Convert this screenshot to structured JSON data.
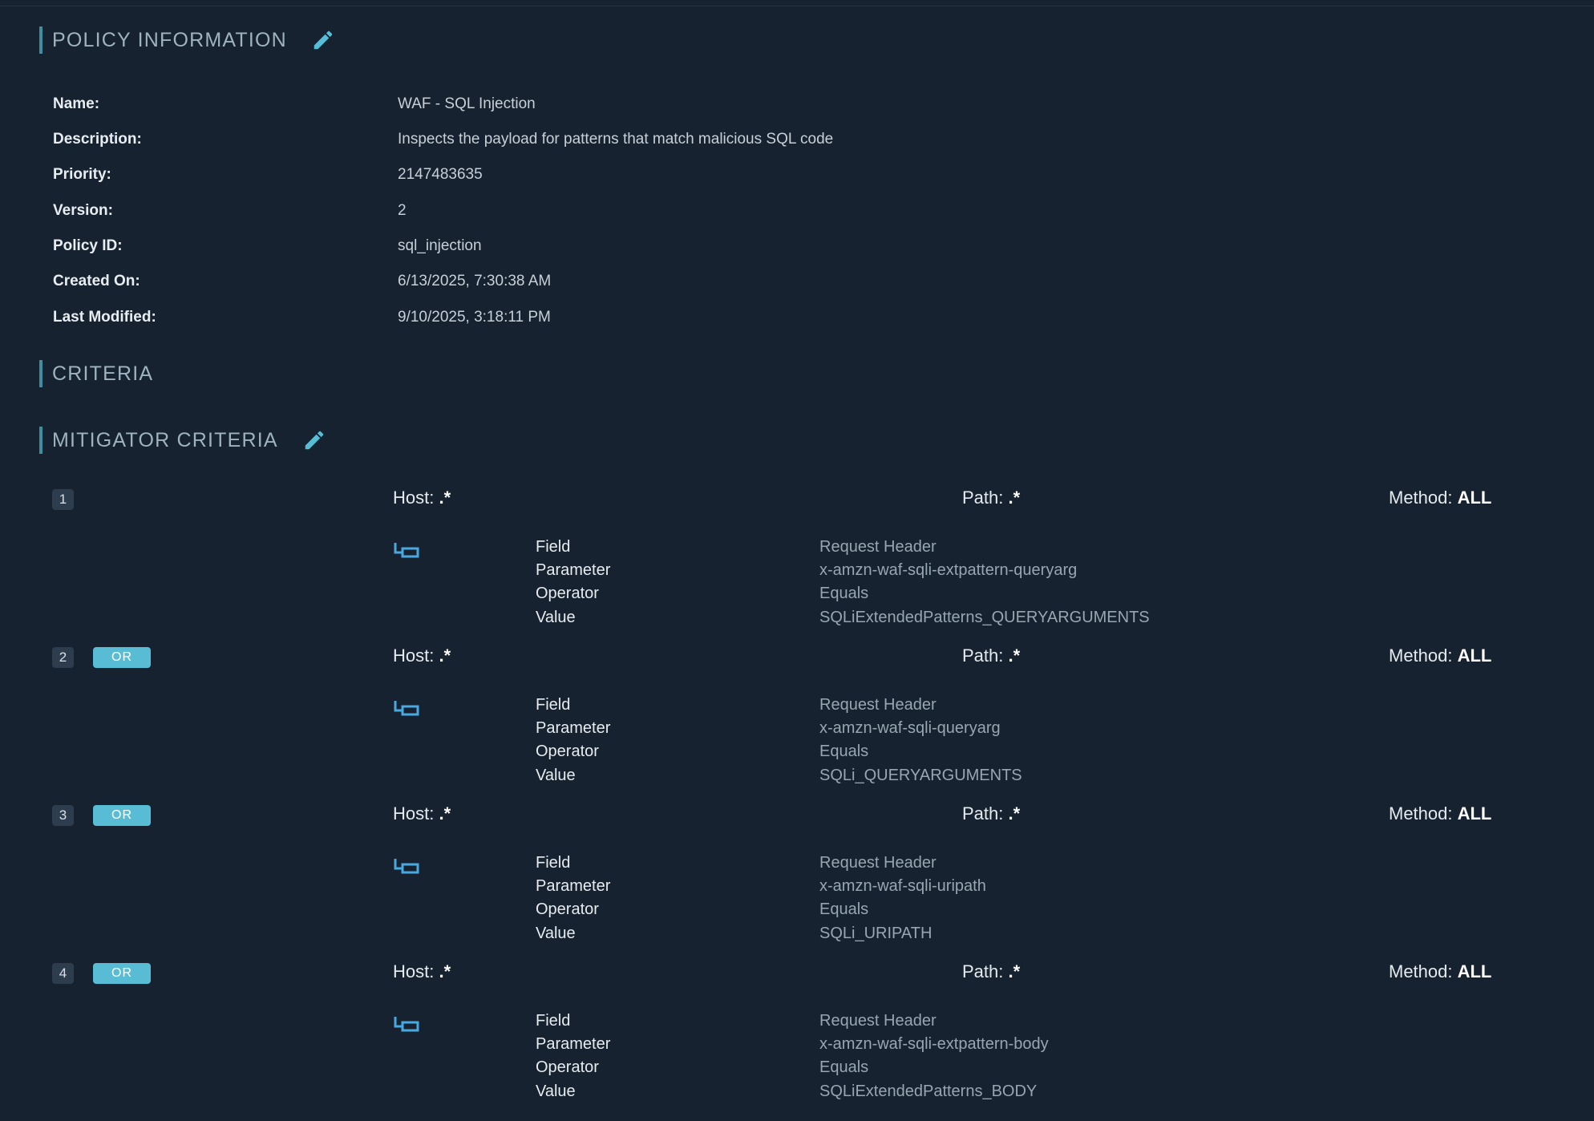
{
  "colors": {
    "background": "#16222f",
    "accent": "#58bdd4",
    "section_bar": "#3f8ea0"
  },
  "policy_section": {
    "title": "POLICY INFORMATION",
    "edit_icon": "pencil-icon",
    "rows": [
      {
        "label": "Name:",
        "value": "WAF - SQL Injection"
      },
      {
        "label": "Description:",
        "value": "Inspects the payload for patterns that match malicious SQL code"
      },
      {
        "label": "Priority:",
        "value": "2147483635"
      },
      {
        "label": "Version:",
        "value": "2"
      },
      {
        "label": "Policy ID:",
        "value": "sql_injection"
      },
      {
        "label": "Created On:",
        "value": "6/13/2025, 7:30:38 AM"
      },
      {
        "label": "Last Modified:",
        "value": "9/10/2025, 3:18:11 PM"
      }
    ]
  },
  "criteria_section": {
    "title": "CRITERIA"
  },
  "mitigator_section": {
    "title": "MITIGATOR CRITERIA",
    "edit_icon": "pencil-icon",
    "labels": {
      "host": "Host: ",
      "path": "Path: ",
      "method": "Method: ",
      "field": "Field",
      "parameter": "Parameter",
      "operator": "Operator",
      "value": "Value"
    },
    "criteria": [
      {
        "number": "1",
        "badge": "",
        "host": ".*",
        "path": ".*",
        "method": "ALL",
        "field": "Request Header",
        "parameter": "x-amzn-waf-sqli-extpattern-queryarg",
        "operator": "Equals",
        "value": "SQLiExtendedPatterns_QUERYARGUMENTS"
      },
      {
        "number": "2",
        "badge": "OR",
        "host": ".*",
        "path": ".*",
        "method": "ALL",
        "field": "Request Header",
        "parameter": "x-amzn-waf-sqli-queryarg",
        "operator": "Equals",
        "value": "SQLi_QUERYARGUMENTS"
      },
      {
        "number": "3",
        "badge": "OR",
        "host": ".*",
        "path": ".*",
        "method": "ALL",
        "field": "Request Header",
        "parameter": "x-amzn-waf-sqli-uripath",
        "operator": "Equals",
        "value": "SQLi_URIPATH"
      },
      {
        "number": "4",
        "badge": "OR",
        "host": ".*",
        "path": ".*",
        "method": "ALL",
        "field": "Request Header",
        "parameter": "x-amzn-waf-sqli-extpattern-body",
        "operator": "Equals",
        "value": "SQLiExtendedPatterns_BODY"
      }
    ]
  }
}
